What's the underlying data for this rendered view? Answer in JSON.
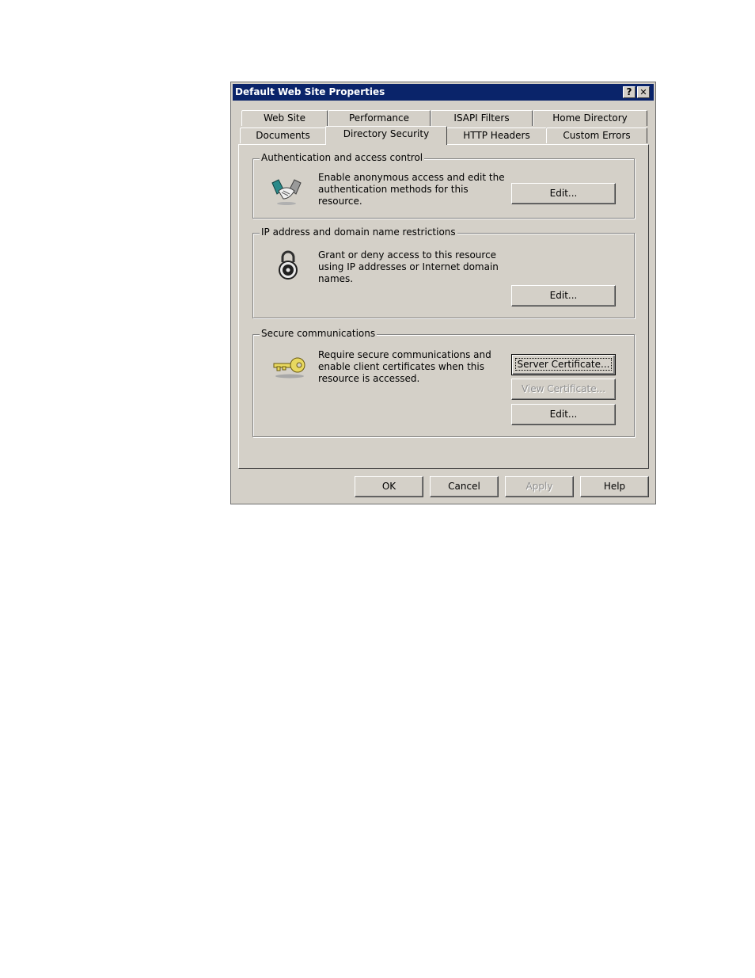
{
  "window": {
    "title": "Default Web Site Properties",
    "help_btn": "?",
    "close_btn": "✕"
  },
  "tabs_row1": [
    {
      "label": "Web Site"
    },
    {
      "label": "Performance"
    },
    {
      "label": "ISAPI Filters"
    },
    {
      "label": "Home Directory"
    }
  ],
  "tabs_row2": [
    {
      "label": "Documents"
    },
    {
      "label": "Directory Security"
    },
    {
      "label": "HTTP Headers"
    },
    {
      "label": "Custom Errors"
    }
  ],
  "auth": {
    "title": "Authentication and access control",
    "text": "Enable anonymous access and edit the authentication methods for this resource.",
    "edit": "Edit...",
    "icon": "handshake-icon"
  },
  "ip": {
    "title": "IP address and domain name restrictions",
    "text": "Grant or deny access to this resource using IP addresses or Internet domain names.",
    "edit": "Edit...",
    "icon": "padlock-icon"
  },
  "secure": {
    "title": "Secure communications",
    "text": "Require secure communications and enable client certificates when this resource is accessed.",
    "server_cert": "Server Certificate...",
    "view_cert": "View Certificate...",
    "edit": "Edit...",
    "icon": "key-icon"
  },
  "footer": {
    "ok": "OK",
    "cancel": "Cancel",
    "apply": "Apply",
    "help": "Help"
  }
}
